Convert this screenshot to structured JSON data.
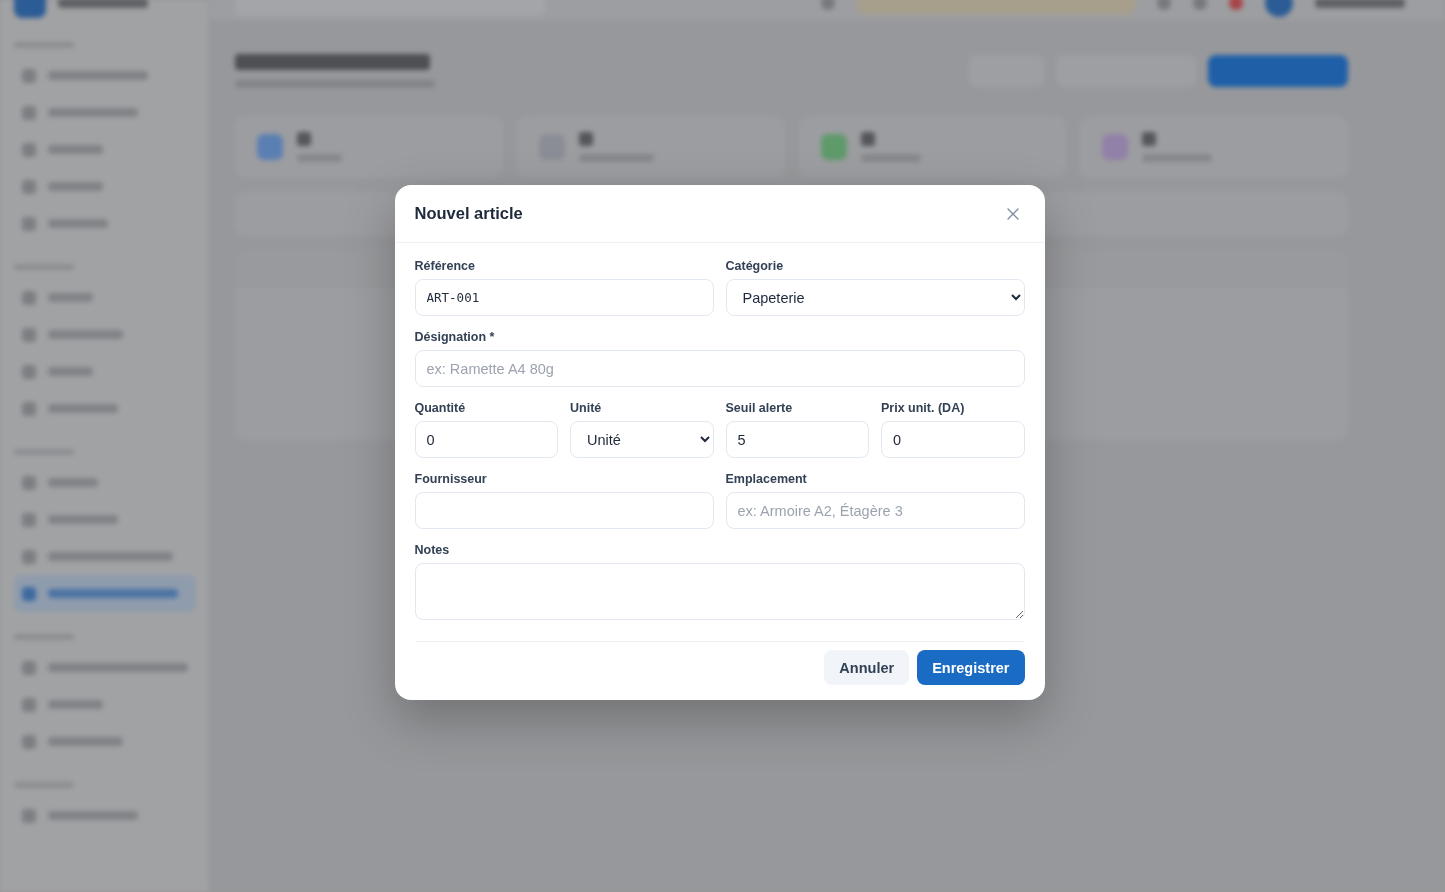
{
  "dialog": {
    "title": "Nouvel article",
    "rows": [
      [
        {
          "kind": "code",
          "label": "Référence",
          "value": "ART-001"
        },
        {
          "kind": "select",
          "label": "Catégorie",
          "value": "Papeterie"
        }
      ],
      [
        {
          "kind": "text",
          "label": "Désignation *",
          "placeholder": "ex: Ramette A4 80g"
        }
      ],
      [
        {
          "kind": "text",
          "label": "Quantité",
          "value": "0"
        },
        {
          "kind": "select",
          "label": "Unité",
          "value": "Unité"
        },
        {
          "kind": "text",
          "label": "Seuil alerte",
          "value": "5"
        },
        {
          "kind": "text",
          "label": "Prix unit. (DA)",
          "value": "0"
        }
      ],
      [
        {
          "kind": "text",
          "label": "Fournisseur"
        },
        {
          "kind": "text",
          "label": "Emplacement",
          "placeholder": "ex: Armoire A2, Étagère 3"
        }
      ],
      [
        {
          "kind": "textarea",
          "label": "Notes"
        }
      ]
    ],
    "buttons": [
      {
        "kind": "secondary",
        "label": "Annuler"
      },
      {
        "kind": "primary",
        "label": "Enregistrer"
      }
    ]
  }
}
